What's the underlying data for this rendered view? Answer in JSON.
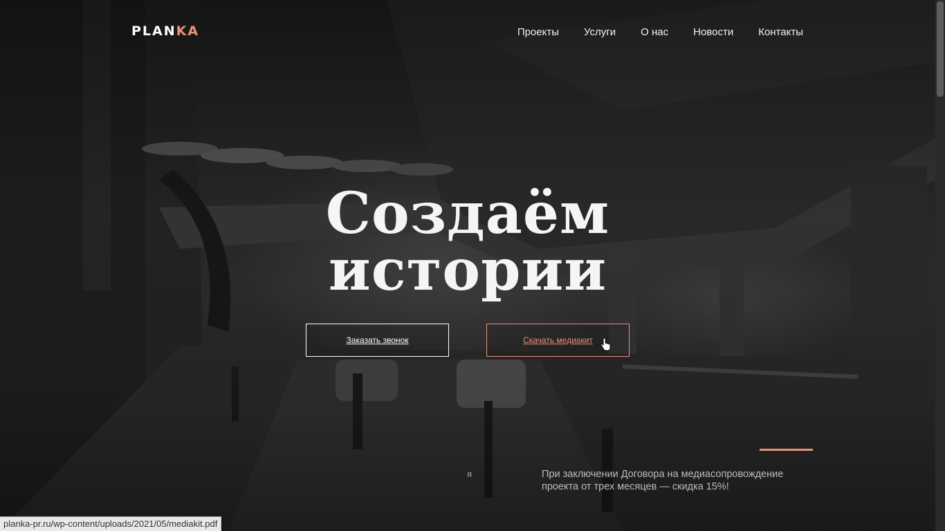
{
  "logo": {
    "main": "PLAN",
    "accent": "KA",
    "accent_color": "#e8937a"
  },
  "nav": {
    "items": [
      {
        "label": "Проекты"
      },
      {
        "label": "Услуги"
      },
      {
        "label": "О нас"
      },
      {
        "label": "Новости"
      },
      {
        "label": "Контакты"
      }
    ]
  },
  "hero": {
    "line1": "Создаём",
    "line2": "истории"
  },
  "buttons": {
    "call": "Заказать звонок",
    "media": "Скачать медиакит"
  },
  "promo": {
    "line1": "При заключении Договора на медиасопровождение",
    "line2": "проекта от трех месяцев — скидка 15%!",
    "stray": "я"
  },
  "status_bar": {
    "url": "planka-pr.ru/wp-content/uploads/2021/05/mediakit.pdf"
  },
  "colors": {
    "accent": "#e8937a",
    "background": "#1d1d1d",
    "text": "#ffffff"
  },
  "icons": {
    "cursor": "hand-pointer-icon"
  }
}
